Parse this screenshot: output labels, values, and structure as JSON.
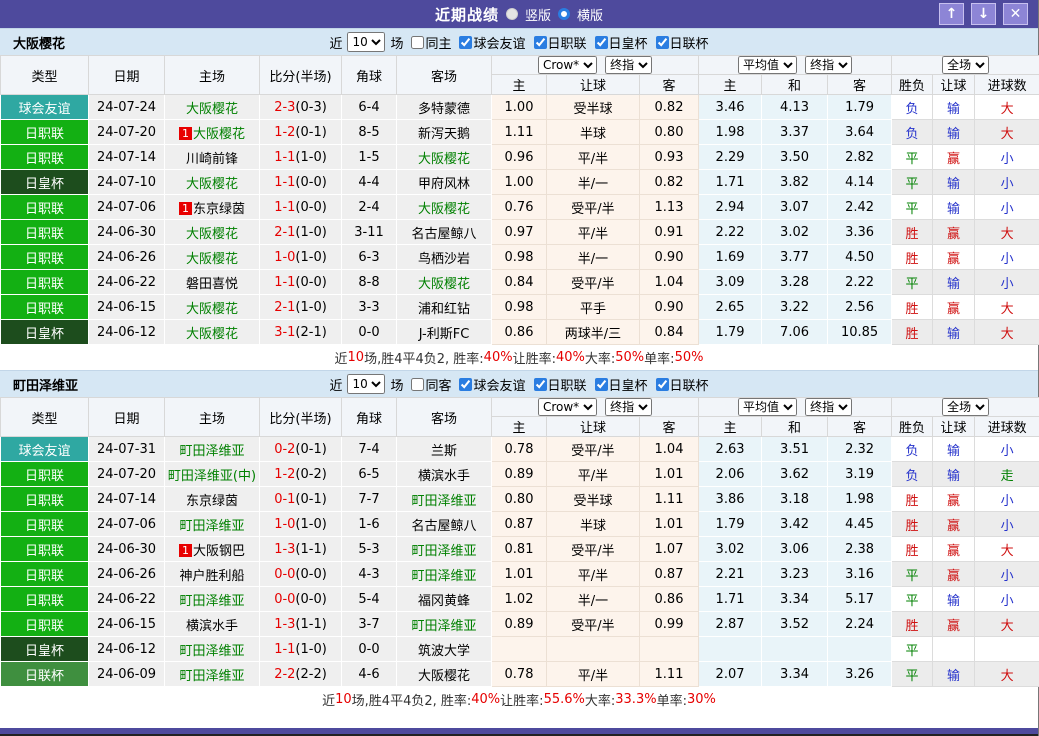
{
  "titlebar": {
    "title": "近期战绩",
    "radio_selected": "竖版",
    "radio_unselected": "横版",
    "buttons": {
      "up": "↑",
      "down": "↓",
      "close": "✕"
    }
  },
  "controls": {
    "near": "近",
    "count": "10",
    "games": "场",
    "crow": "Crow*",
    "final": "终指",
    "average": "平均值",
    "full": "全场"
  },
  "filters": {
    "leagues": [
      "球会友谊",
      "日职联",
      "日皇杯",
      "日联杯"
    ]
  },
  "header": {
    "left": [
      "类型",
      "日期",
      "主场",
      "比分(半场)",
      "角球",
      "客场"
    ],
    "odds": [
      "主",
      "让球",
      "客"
    ],
    "avg": [
      "主",
      "和",
      "客"
    ],
    "result": [
      "胜负",
      "让球",
      "进球数"
    ]
  },
  "colors": {
    "titlebar_bg": "#4e4a9d",
    "button_bg": "#8d85d6",
    "filterbar_bg": "#d6e7f4",
    "check_accent": "#2a7de1",
    "focus_team": "#008000",
    "score_red": "#e60000",
    "result_red": "#cf1010",
    "result_blue": "#2633cc",
    "result_green": "#008000",
    "odds_bg": "#fdf4ec",
    "avg_bg": "#e9f4f9",
    "type_colors": {
      "球会友谊": "#2fa8a2",
      "日职联": "#13b013",
      "日皇杯": "#1d4d1d",
      "日联杯": "#3f8f3f"
    }
  },
  "sections": [
    {
      "team": "大阪樱花",
      "same_label": "同主",
      "rows": [
        {
          "type": "球会友谊",
          "date": "24-07-24",
          "home": "大阪樱花",
          "home_focus": true,
          "score": "2-3",
          "half": "(0-3)",
          "corner": "6-4",
          "away": "多特蒙德",
          "away_focus": false,
          "odds": [
            "1.00",
            "受半球",
            "0.82"
          ],
          "avg": [
            "3.46",
            "4.13",
            "1.79"
          ],
          "result": [
            "负",
            "输",
            "大"
          ]
        },
        {
          "type": "日职联",
          "date": "24-07-20",
          "home": "大阪樱花",
          "home_focus": true,
          "home_badge": "1",
          "score": "1-2",
          "half": "(0-1)",
          "corner": "8-5",
          "away": "新泻天鹅",
          "away_focus": false,
          "odds": [
            "1.11",
            "半球",
            "0.80"
          ],
          "avg": [
            "1.98",
            "3.37",
            "3.64"
          ],
          "result": [
            "负",
            "输",
            "大"
          ]
        },
        {
          "type": "日职联",
          "date": "24-07-14",
          "home": "川崎前锋",
          "home_focus": false,
          "score": "1-1",
          "half": "(1-0)",
          "corner": "1-5",
          "away": "大阪樱花",
          "away_focus": true,
          "odds": [
            "0.96",
            "平/半",
            "0.93"
          ],
          "avg": [
            "2.29",
            "3.50",
            "2.82"
          ],
          "result": [
            "平",
            "赢",
            "小"
          ]
        },
        {
          "type": "日皇杯",
          "date": "24-07-10",
          "home": "大阪樱花",
          "home_focus": true,
          "score": "1-1",
          "half": "(0-0)",
          "corner": "4-4",
          "away": "甲府风林",
          "away_focus": false,
          "odds": [
            "1.00",
            "半/一",
            "0.82"
          ],
          "avg": [
            "1.71",
            "3.82",
            "4.14"
          ],
          "result": [
            "平",
            "输",
            "小"
          ]
        },
        {
          "type": "日职联",
          "date": "24-07-06",
          "home": "东京绿茵",
          "home_focus": false,
          "home_badge": "1",
          "score": "1-1",
          "half": "(0-0)",
          "corner": "2-4",
          "away": "大阪樱花",
          "away_focus": true,
          "odds": [
            "0.76",
            "受平/半",
            "1.13"
          ],
          "avg": [
            "2.94",
            "3.07",
            "2.42"
          ],
          "result": [
            "平",
            "输",
            "小"
          ]
        },
        {
          "type": "日职联",
          "date": "24-06-30",
          "home": "大阪樱花",
          "home_focus": true,
          "score": "2-1",
          "half": "(1-0)",
          "corner": "3-11",
          "away": "名古屋鲸八",
          "away_focus": false,
          "odds": [
            "0.97",
            "平/半",
            "0.91"
          ],
          "avg": [
            "2.22",
            "3.02",
            "3.36"
          ],
          "result": [
            "胜",
            "赢",
            "大"
          ]
        },
        {
          "type": "日职联",
          "date": "24-06-26",
          "home": "大阪樱花",
          "home_focus": true,
          "score": "1-0",
          "half": "(1-0)",
          "corner": "6-3",
          "away": "鸟栖沙岩",
          "away_focus": false,
          "odds": [
            "0.98",
            "半/一",
            "0.90"
          ],
          "avg": [
            "1.69",
            "3.77",
            "4.50"
          ],
          "result": [
            "胜",
            "赢",
            "小"
          ]
        },
        {
          "type": "日职联",
          "date": "24-06-22",
          "home": "磐田喜悦",
          "home_focus": false,
          "score": "1-1",
          "half": "(0-0)",
          "corner": "8-8",
          "away": "大阪樱花",
          "away_focus": true,
          "odds": [
            "0.84",
            "受平/半",
            "1.04"
          ],
          "avg": [
            "3.09",
            "3.28",
            "2.22"
          ],
          "result": [
            "平",
            "输",
            "小"
          ]
        },
        {
          "type": "日职联",
          "date": "24-06-15",
          "home": "大阪樱花",
          "home_focus": true,
          "score": "2-1",
          "half": "(1-0)",
          "corner": "3-3",
          "away": "浦和红钻",
          "away_focus": false,
          "odds": [
            "0.98",
            "平手",
            "0.90"
          ],
          "avg": [
            "2.65",
            "3.22",
            "2.56"
          ],
          "result": [
            "胜",
            "赢",
            "大"
          ]
        },
        {
          "type": "日皇杯",
          "date": "24-06-12",
          "home": "大阪樱花",
          "home_focus": true,
          "score": "3-1",
          "half": "(2-1)",
          "corner": "0-0",
          "away": "J-利斯FC",
          "away_focus": false,
          "odds": [
            "0.86",
            "两球半/三",
            "0.84"
          ],
          "avg": [
            "1.79",
            "7.06",
            "10.85"
          ],
          "result": [
            "胜",
            "输",
            "大"
          ]
        }
      ],
      "summary": [
        {
          "t": "近",
          "c": "k"
        },
        {
          "t": "10",
          "c": "r"
        },
        {
          "t": "场,胜4平4负2, 胜率:",
          "c": "k"
        },
        {
          "t": "40%",
          "c": "r"
        },
        {
          "t": " 让胜率:",
          "c": "k"
        },
        {
          "t": "40%",
          "c": "r"
        },
        {
          "t": " 大率:",
          "c": "k"
        },
        {
          "t": "50%",
          "c": "r"
        },
        {
          "t": " 单率:",
          "c": "k"
        },
        {
          "t": "50%",
          "c": "r"
        }
      ]
    },
    {
      "team": "町田泽维亚",
      "same_label": "同客",
      "rows": [
        {
          "type": "球会友谊",
          "date": "24-07-31",
          "home": "町田泽维亚",
          "home_focus": true,
          "score": "0-2",
          "half": "(0-1)",
          "corner": "7-4",
          "away": "兰斯",
          "away_focus": false,
          "odds": [
            "0.78",
            "受平/半",
            "1.04"
          ],
          "avg": [
            "2.63",
            "3.51",
            "2.32"
          ],
          "result": [
            "负",
            "输",
            "小"
          ]
        },
        {
          "type": "日职联",
          "date": "24-07-20",
          "home": "町田泽维亚(中)",
          "home_focus": true,
          "score": "1-2",
          "half": "(0-2)",
          "corner": "6-5",
          "away": "横滨水手",
          "away_focus": false,
          "odds": [
            "0.89",
            "平/半",
            "1.01"
          ],
          "avg": [
            "2.06",
            "3.62",
            "3.19"
          ],
          "result": [
            "负",
            "输",
            "走"
          ]
        },
        {
          "type": "日职联",
          "date": "24-07-14",
          "home": "东京绿茵",
          "home_focus": false,
          "score": "0-1",
          "half": "(0-1)",
          "corner": "7-7",
          "away": "町田泽维亚",
          "away_focus": true,
          "odds": [
            "0.80",
            "受半球",
            "1.11"
          ],
          "avg": [
            "3.86",
            "3.18",
            "1.98"
          ],
          "result": [
            "胜",
            "赢",
            "小"
          ]
        },
        {
          "type": "日职联",
          "date": "24-07-06",
          "home": "町田泽维亚",
          "home_focus": true,
          "score": "1-0",
          "half": "(1-0)",
          "corner": "1-6",
          "away": "名古屋鲸八",
          "away_focus": false,
          "odds": [
            "0.87",
            "半球",
            "1.01"
          ],
          "avg": [
            "1.79",
            "3.42",
            "4.45"
          ],
          "result": [
            "胜",
            "赢",
            "小"
          ]
        },
        {
          "type": "日职联",
          "date": "24-06-30",
          "home": "大阪钢巴",
          "home_focus": false,
          "home_badge": "1",
          "score": "1-3",
          "half": "(1-1)",
          "corner": "5-3",
          "away": "町田泽维亚",
          "away_focus": true,
          "odds": [
            "0.81",
            "受平/半",
            "1.07"
          ],
          "avg": [
            "3.02",
            "3.06",
            "2.38"
          ],
          "result": [
            "胜",
            "赢",
            "大"
          ]
        },
        {
          "type": "日职联",
          "date": "24-06-26",
          "home": "神户胜利船",
          "home_focus": false,
          "score": "0-0",
          "half": "(0-0)",
          "corner": "4-3",
          "away": "町田泽维亚",
          "away_focus": true,
          "odds": [
            "1.01",
            "平/半",
            "0.87"
          ],
          "avg": [
            "2.21",
            "3.23",
            "3.16"
          ],
          "result": [
            "平",
            "赢",
            "小"
          ]
        },
        {
          "type": "日职联",
          "date": "24-06-22",
          "home": "町田泽维亚",
          "home_focus": true,
          "score": "0-0",
          "half": "(0-0)",
          "corner": "5-4",
          "away": "福冈黄蜂",
          "away_focus": false,
          "odds": [
            "1.02",
            "半/一",
            "0.86"
          ],
          "avg": [
            "1.71",
            "3.34",
            "5.17"
          ],
          "result": [
            "平",
            "输",
            "小"
          ]
        },
        {
          "type": "日职联",
          "date": "24-06-15",
          "home": "横滨水手",
          "home_focus": false,
          "score": "1-3",
          "half": "(1-1)",
          "corner": "3-7",
          "away": "町田泽维亚",
          "away_focus": true,
          "odds": [
            "0.89",
            "受平/半",
            "0.99"
          ],
          "avg": [
            "2.87",
            "3.52",
            "2.24"
          ],
          "result": [
            "胜",
            "赢",
            "大"
          ]
        },
        {
          "type": "日皇杯",
          "date": "24-06-12",
          "home": "町田泽维亚",
          "home_focus": true,
          "score": "1-1",
          "half": "(1-0)",
          "corner": "0-0",
          "away": "筑波大学",
          "away_focus": false,
          "odds": [
            "",
            "",
            ""
          ],
          "avg": [
            "",
            "",
            ""
          ],
          "result": [
            "平",
            "",
            ""
          ]
        },
        {
          "type": "日联杯",
          "date": "24-06-09",
          "home": "町田泽维亚",
          "home_focus": true,
          "score": "2-2",
          "half": "(2-2)",
          "corner": "4-6",
          "away": "大阪樱花",
          "away_focus": false,
          "odds": [
            "0.78",
            "平/半",
            "1.11"
          ],
          "avg": [
            "2.07",
            "3.34",
            "3.26"
          ],
          "result": [
            "平",
            "输",
            "大"
          ]
        }
      ],
      "summary": [
        {
          "t": "近",
          "c": "k"
        },
        {
          "t": "10",
          "c": "r"
        },
        {
          "t": "场,胜4平4负2, 胜率:",
          "c": "k"
        },
        {
          "t": "40%",
          "c": "r"
        },
        {
          "t": " 让胜率:",
          "c": "k"
        },
        {
          "t": "55.6%",
          "c": "r"
        },
        {
          "t": " 大率:",
          "c": "k"
        },
        {
          "t": "33.3%",
          "c": "r"
        },
        {
          "t": " 单率:",
          "c": "k"
        },
        {
          "t": "30%",
          "c": "r"
        }
      ]
    }
  ]
}
